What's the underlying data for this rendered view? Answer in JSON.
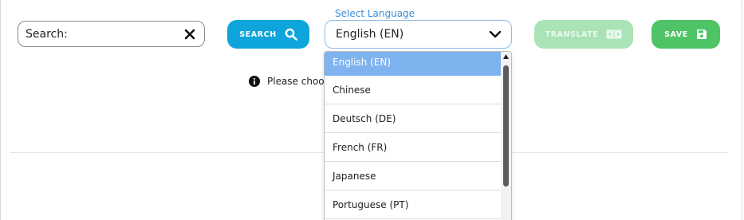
{
  "search": {
    "placeholder": "Search:",
    "button_label": "SEARCH"
  },
  "language": {
    "label": "Select Language",
    "selected": "English (EN)",
    "options": [
      "English (EN)",
      "Chinese",
      "Deutsch (DE)",
      "French (FR)",
      "Japanese",
      "Portuguese (PT)"
    ]
  },
  "toolbar": {
    "translate_label": "TRANSLATE",
    "save_label": "SAVE"
  },
  "info": {
    "message": "Please choos"
  },
  "colors": {
    "primary": "#0ea5dc",
    "save": "#4fc466",
    "translate_disabled": "#a9e3b6",
    "highlight": "#7fb3f0",
    "label": "#3a8fd8"
  },
  "icons": {
    "clear": "close-icon",
    "search": "search-icon",
    "chevron": "chevron-down-icon",
    "translate": "translate-icon",
    "save": "floppy-disk-icon",
    "info": "info-circle-icon",
    "scroll_up": "scroll-up-arrow-icon"
  }
}
